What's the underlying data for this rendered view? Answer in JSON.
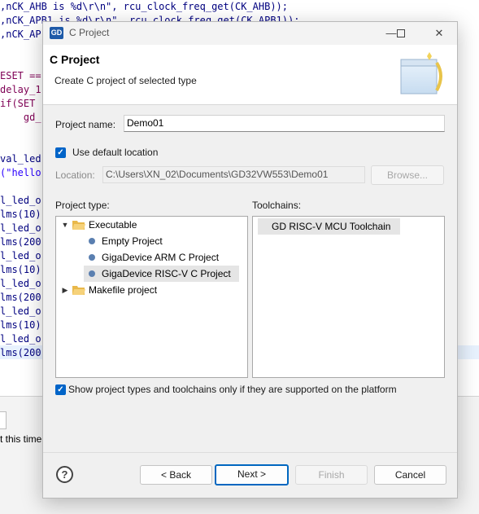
{
  "editor": {
    "lines": [
      ",nCK_AHB is %d\\r\\n\", rcu_clock_freq_get(CK_AHB));",
      ",nCK_APB1 is %d\\r\\n\", rcu_clock_freq_get(CK_APB1));",
      ",nCK_AP",
      "",
      "ESET ==",
      "delay_1",
      "if(SET",
      "    gd_",
      "",
      "val_led",
      "(\"hello",
      "",
      "l_led_o",
      "lms(10)",
      "l_led_o",
      "lms(200",
      "l_led_o",
      "lms(10)",
      "l_led_o",
      "lms(200",
      "l_led_o",
      "lms(10)",
      "l_led_o",
      "lms(200"
    ],
    "status_text": "t this time"
  },
  "dialog": {
    "window_title": "C Project",
    "title_icon_text": "GD",
    "banner_title": "C Project",
    "banner_description": "Create C project of selected type",
    "project_name_label": "Project name:",
    "project_name_value": "Demo01",
    "use_default_location_label": "Use default location",
    "location_label": "Location:",
    "location_value": "C:\\Users\\XN_02\\Documents\\GD32VW553\\Demo01",
    "browse_label": "Browse...",
    "project_type_label": "Project type:",
    "toolchains_label": "Toolchains:",
    "project_types": [
      {
        "label": "Executable",
        "kind": "folder",
        "expanded": true
      },
      {
        "label": "Empty Project",
        "kind": "item"
      },
      {
        "label": "GigaDevice ARM C Project",
        "kind": "item"
      },
      {
        "label": "GigaDevice RISC-V C Project",
        "kind": "item",
        "selected": true
      },
      {
        "label": "Makefile project",
        "kind": "folder",
        "expanded": false
      }
    ],
    "toolchains": [
      "GD RISC-V MCU Toolchain"
    ],
    "show_supported_label": "Show project types and toolchains only if they are supported on the platform",
    "buttons": {
      "help": "?",
      "back": "< Back",
      "next": "Next >",
      "finish": "Finish",
      "cancel": "Cancel"
    }
  },
  "colors": {
    "accent": "#0064c8",
    "selection": "#e5e5e5",
    "code_string": "#2a00ff"
  }
}
